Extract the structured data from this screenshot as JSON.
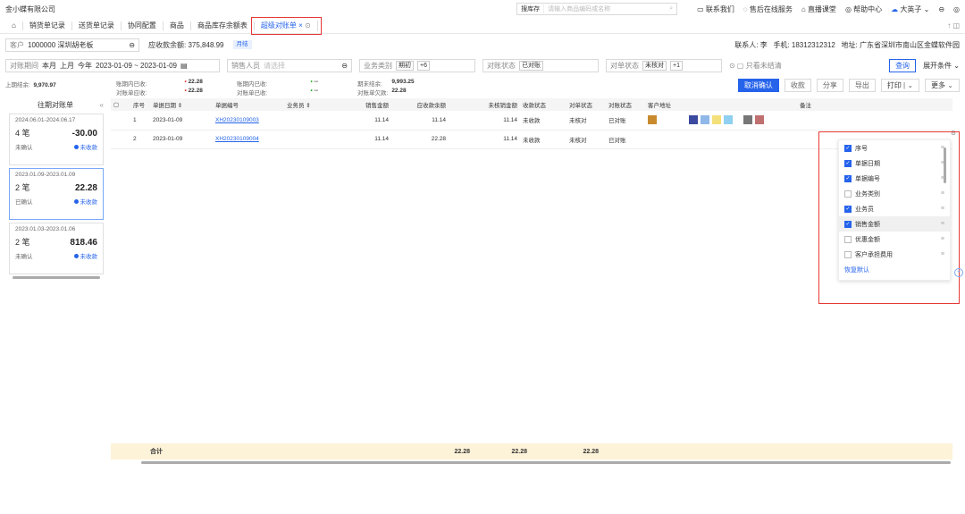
{
  "top": {
    "company": "金小蝶有限公司",
    "search_label": "搜库存",
    "search_placeholder": "请输入商品编码或名称",
    "links": [
      "联系我们",
      "售后在线服务",
      "直播课堂",
      "帮助中心",
      "大英子"
    ]
  },
  "tabs": [
    "销货单记录",
    "送货单记录",
    "协同配置",
    "商品",
    "商品库存余额表",
    "超级对账单"
  ],
  "row1": {
    "customer_label": "客户",
    "customer_value": "1000000 深圳胡老板",
    "receivable_label": "应收款余额:",
    "receivable_value": "375,848.99",
    "badge": "月结",
    "contact_label": "联系人:",
    "contact_value": "李",
    "phone_label": "手机:",
    "phone_value": "18312312312",
    "addr_label": "地址:",
    "addr_value": "广东省深圳市南山区金蝶软件园"
  },
  "row2": {
    "period_label": "对账期间",
    "p1": "本月",
    "p2": "上月",
    "p3": "今年",
    "date_range": "2023-01-09 ~ 2023-01-09",
    "sales_label": "销售人员",
    "sales_ph": "请选择",
    "biz_label": "业务类别",
    "biz_tag": "期初",
    "biz_more": "+6",
    "rec_label": "对账状态",
    "rec_tag": "已对账",
    "order_label": "对单状态",
    "order_tag": "未核对",
    "order_more": "+1",
    "only": "只看未结清",
    "query": "查询",
    "expand": "展开条件"
  },
  "summary": {
    "prev_label": "上期结余:",
    "prev_value": "9,970.97",
    "a1": "账期内已收:",
    "a1v": "22.28",
    "a2": "对账单应收:",
    "a2v": "22.28",
    "b1": "账期内已收:",
    "b1v": "--",
    "b2": "对账单已收:",
    "b2v": "--",
    "c1": "期末结余:",
    "c1v": "9,993.25",
    "c2": "对账单欠款:",
    "c2v": "22.28"
  },
  "actions": [
    "取消确认",
    "收款",
    "分享",
    "导出",
    "打印",
    "更多"
  ],
  "left": {
    "title": "往期对账单",
    "cards": [
      {
        "period": "2024.06.01-2024.06.17",
        "count": "4 笔",
        "amount": "-30.00",
        "status": "未确认",
        "pay": "未收款"
      },
      {
        "period": "2023.01.09-2023.01.09",
        "count": "2 笔",
        "amount": "22.28",
        "status": "已确认",
        "pay": "未收款"
      },
      {
        "period": "2023.01.03-2023.01.06",
        "count": "2 笔",
        "amount": "818.46",
        "status": "未确认",
        "pay": "未收款"
      }
    ]
  },
  "table": {
    "headers": [
      "序号",
      "单据日期",
      "单据编号",
      "业务员",
      "销售金额",
      "应收款余额",
      "未核销金额",
      "收款状态",
      "对单状态",
      "对账状态",
      "客户地址",
      "备注"
    ],
    "rows": [
      {
        "no": "1",
        "date": "2023-01-09",
        "code": "XH20230109003",
        "staff": "",
        "sale": "11.14",
        "bal": "11.14",
        "unv": "11.14",
        "pay": "未收款",
        "order": "未核对",
        "rec": "已对账"
      },
      {
        "no": "2",
        "date": "2023-01-09",
        "code": "XH20230109004",
        "staff": "",
        "sale": "11.14",
        "bal": "22.28",
        "unv": "11.14",
        "pay": "未收款",
        "order": "未核对",
        "rec": "已对账"
      }
    ],
    "total_label": "合计",
    "tot_sale": "22.28",
    "tot_bal": "22.28",
    "tot_unv": "22.28"
  },
  "panel": {
    "items": [
      {
        "label": "序号",
        "on": true
      },
      {
        "label": "单据日期",
        "on": true
      },
      {
        "label": "单据编号",
        "on": true
      },
      {
        "label": "业务类别",
        "on": false
      },
      {
        "label": "业务员",
        "on": true
      },
      {
        "label": "销售金额",
        "on": true
      },
      {
        "label": "优惠金额",
        "on": false
      },
      {
        "label": "客户承担费用",
        "on": false
      }
    ],
    "reset": "恢复默认"
  },
  "colors": {
    "accent": "#2563eb",
    "highlight": "#e53935"
  }
}
